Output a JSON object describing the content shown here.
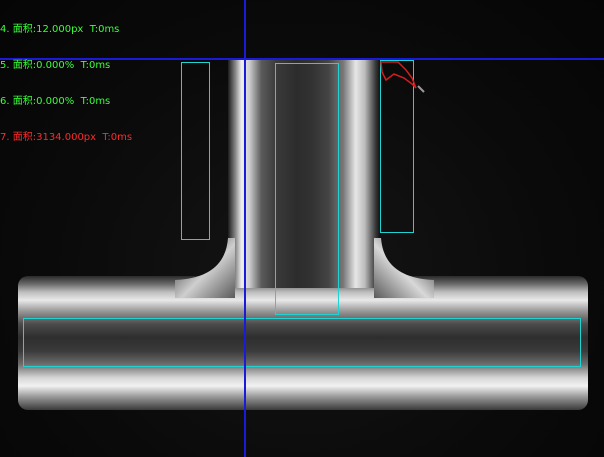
{
  "overlay": {
    "lines": [
      {
        "text": "4. 面积:12.000px  T:0ms",
        "color": "#39ff39"
      },
      {
        "text": "5. 面积:0.000%  T:0ms",
        "color": "#39ff39"
      },
      {
        "text": "6. 面积:0.000%  T:0ms",
        "color": "#39ff39"
      },
      {
        "text": "7. 面积:3134.000px  T:0ms",
        "color": "#ff2a2a"
      }
    ]
  },
  "colors": {
    "roi_box": "#1fd3d3",
    "crosshair": "#1a1ad8",
    "defect_outline": "#d21e1e"
  }
}
